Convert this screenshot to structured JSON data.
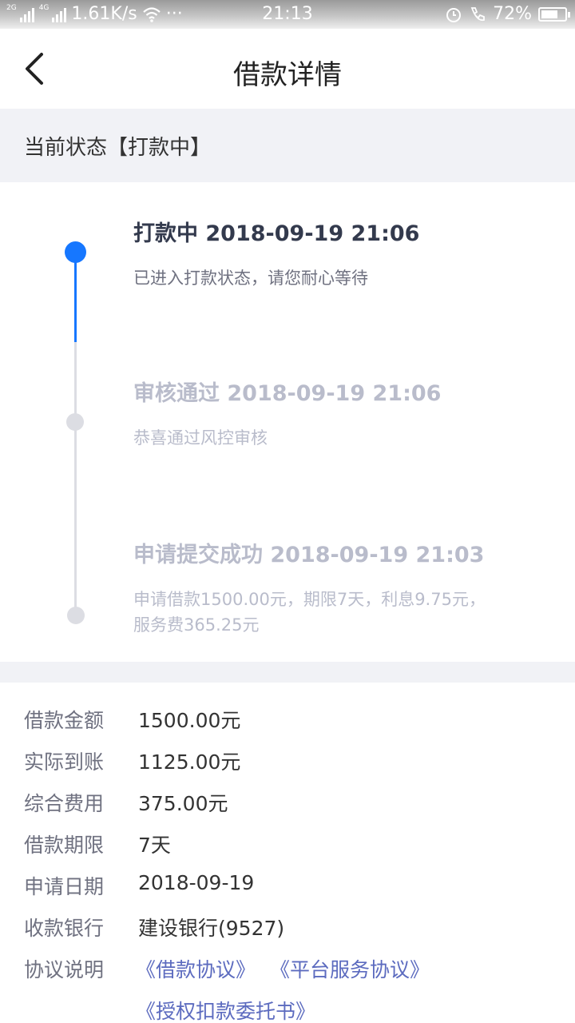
{
  "status_bar": {
    "network_left": "2G",
    "network_right": "4G",
    "speed": "1.61K/s",
    "more": "···",
    "time": "21:13",
    "battery_text": "72%",
    "battery_level": 0.72
  },
  "header": {
    "title": "借款详情"
  },
  "current_status": {
    "text": "当前状态【打款中】"
  },
  "timeline": [
    {
      "title": "打款中 2018-09-19 21:06",
      "desc": "已进入打款状态，请您耐心等待",
      "active": true
    },
    {
      "title": "审核通过 2018-09-19 21:06",
      "desc": "恭喜通过风控审核",
      "active": false
    },
    {
      "title": "申请提交成功 2018-09-19 21:03",
      "desc": "申请借款1500.00元，期限7天，利息9.75元，服务费365.25元",
      "active": false
    }
  ],
  "details": [
    {
      "label": "借款金额",
      "value": "1500.00元"
    },
    {
      "label": "实际到账",
      "value": "1125.00元"
    },
    {
      "label": "综合费用",
      "value": "375.00元"
    },
    {
      "label": "借款期限",
      "value": "7天"
    },
    {
      "label": "申请日期",
      "value": "2018-09-19"
    },
    {
      "label": "收款银行",
      "value": "建设银行(9527)"
    }
  ],
  "agreements": {
    "label": "协议说明",
    "links": [
      "《借款协议》",
      "《平台服务协议》",
      "《授权扣款委托书》"
    ]
  },
  "colors": {
    "accent": "#1677ff",
    "inactive": "#b9bccb",
    "link": "#5c6bbf"
  }
}
